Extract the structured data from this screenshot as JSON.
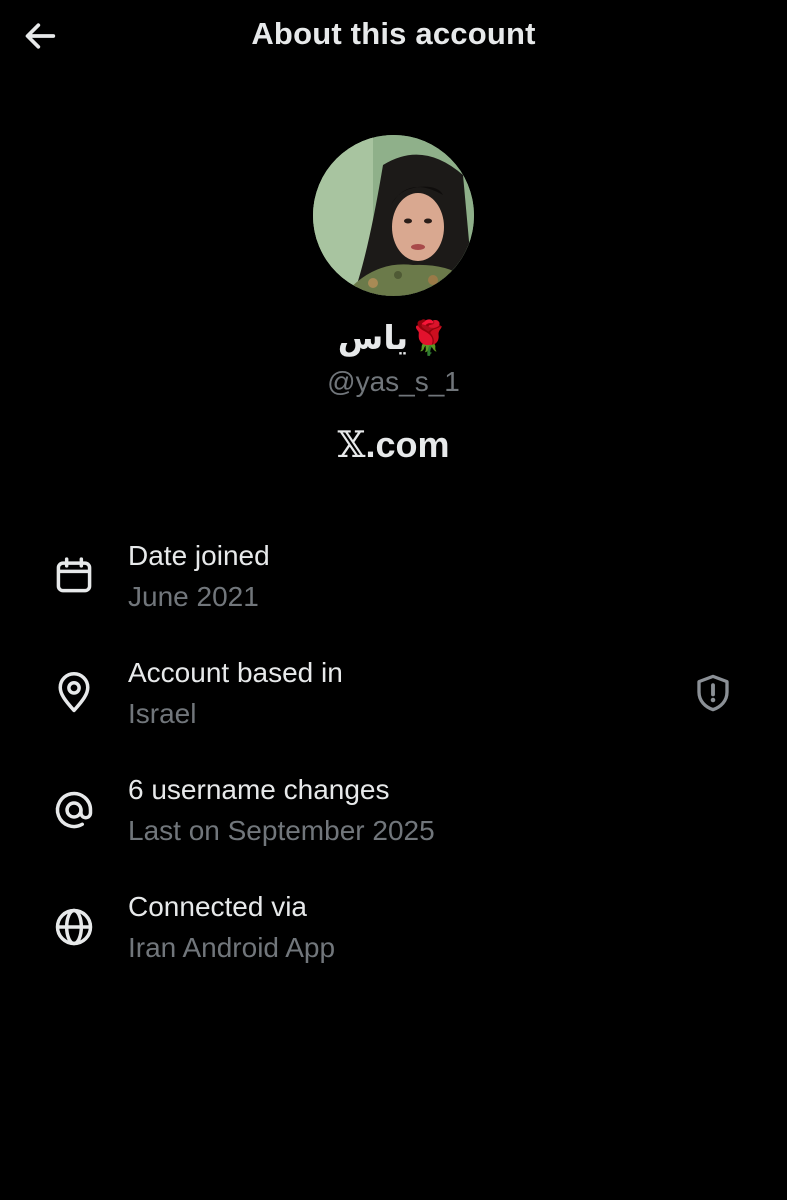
{
  "header": {
    "title": "About this account",
    "back_icon": "arrow-left-icon"
  },
  "profile": {
    "display_name": "یاس🌹",
    "handle": "@yas_s_1",
    "site_prefix": "𝕏",
    "site_suffix": ".com"
  },
  "details": [
    {
      "icon": "calendar-icon",
      "title": "Date joined",
      "value": "June 2021"
    },
    {
      "icon": "location-pin-icon",
      "title": "Account based in",
      "value": "Israel",
      "badge_icon": "shield-exclamation-icon"
    },
    {
      "icon": "at-sign-icon",
      "title": "6 username changes",
      "value": "Last on September 2025"
    },
    {
      "icon": "globe-icon",
      "title": "Connected via",
      "value": "Iran Android App"
    }
  ],
  "colors": {
    "background": "#000000",
    "primary_text": "#e7e9ea",
    "secondary_text": "#71767b"
  }
}
